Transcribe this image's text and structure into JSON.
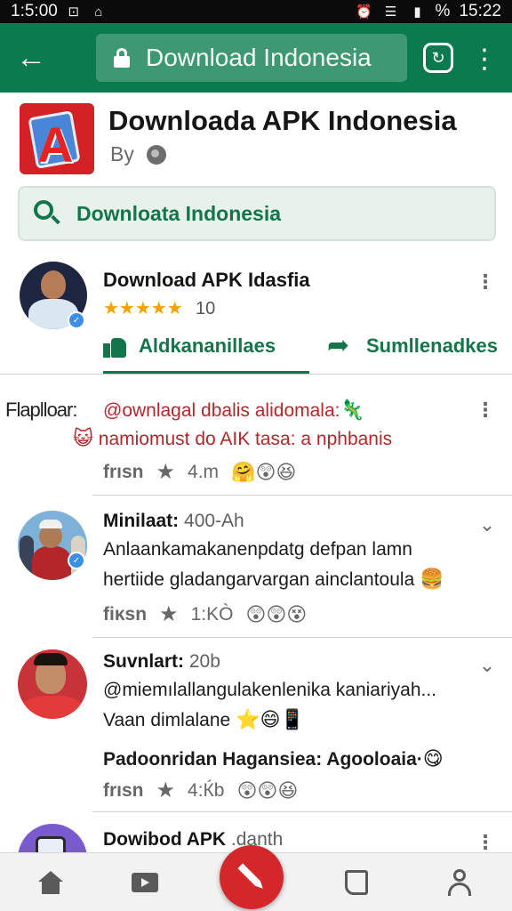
{
  "status_bar": {
    "left_time": "1:5:00",
    "right_time": "15:22",
    "battery": "%"
  },
  "toolbar": {
    "url": "Download Indonesia"
  },
  "app": {
    "title": "Downloada APK Indonesia",
    "by": "By"
  },
  "search": {
    "value": "Downloata Indonesia"
  },
  "featured": {
    "name": "Download APK Idasfia",
    "stars": "★★★★★",
    "rating": "10",
    "action_left": "Aldkananillaes",
    "action_right": "Sumllenadkes"
  },
  "comments": [
    {
      "gap_label": "Flaplloar:",
      "line1": "@ownlagal dbalis alidomala:",
      "line1_emoji": "🦎",
      "line2_emoji": "😺",
      "line2": "namiomust do AIK tasa: a nphbanis",
      "meta_label": "frısn",
      "meta_count": "4.m",
      "meta_emojis": "🤗😲😆"
    },
    {
      "name": "Minilaat:",
      "time": "400-Ah",
      "line1": "Anlaankamakanenpdatg defpan lamn",
      "line2": "hertiide gladangarvargan ainclantoula",
      "line2_emoji": "🍔",
      "meta_label": "fiκsn",
      "meta_count": "1:ΚÒ",
      "meta_emojis": "😲😲😵"
    },
    {
      "name": "Suvnlart:",
      "time": "20b",
      "line1": "@miemılallangulakenlenika kaniariyah...",
      "line2": "Vaan dimlalane",
      "line2_emoji": "⭐😄📱",
      "line3": "Padoonridan Hagansiea: Agooloaia·",
      "line3_emoji": "😋",
      "meta_label": "frısn",
      "meta_count": "4:Ќb",
      "meta_emojis": "😲😲😆"
    },
    {
      "name": "Dowibod APK",
      "time": ".danth"
    }
  ]
}
